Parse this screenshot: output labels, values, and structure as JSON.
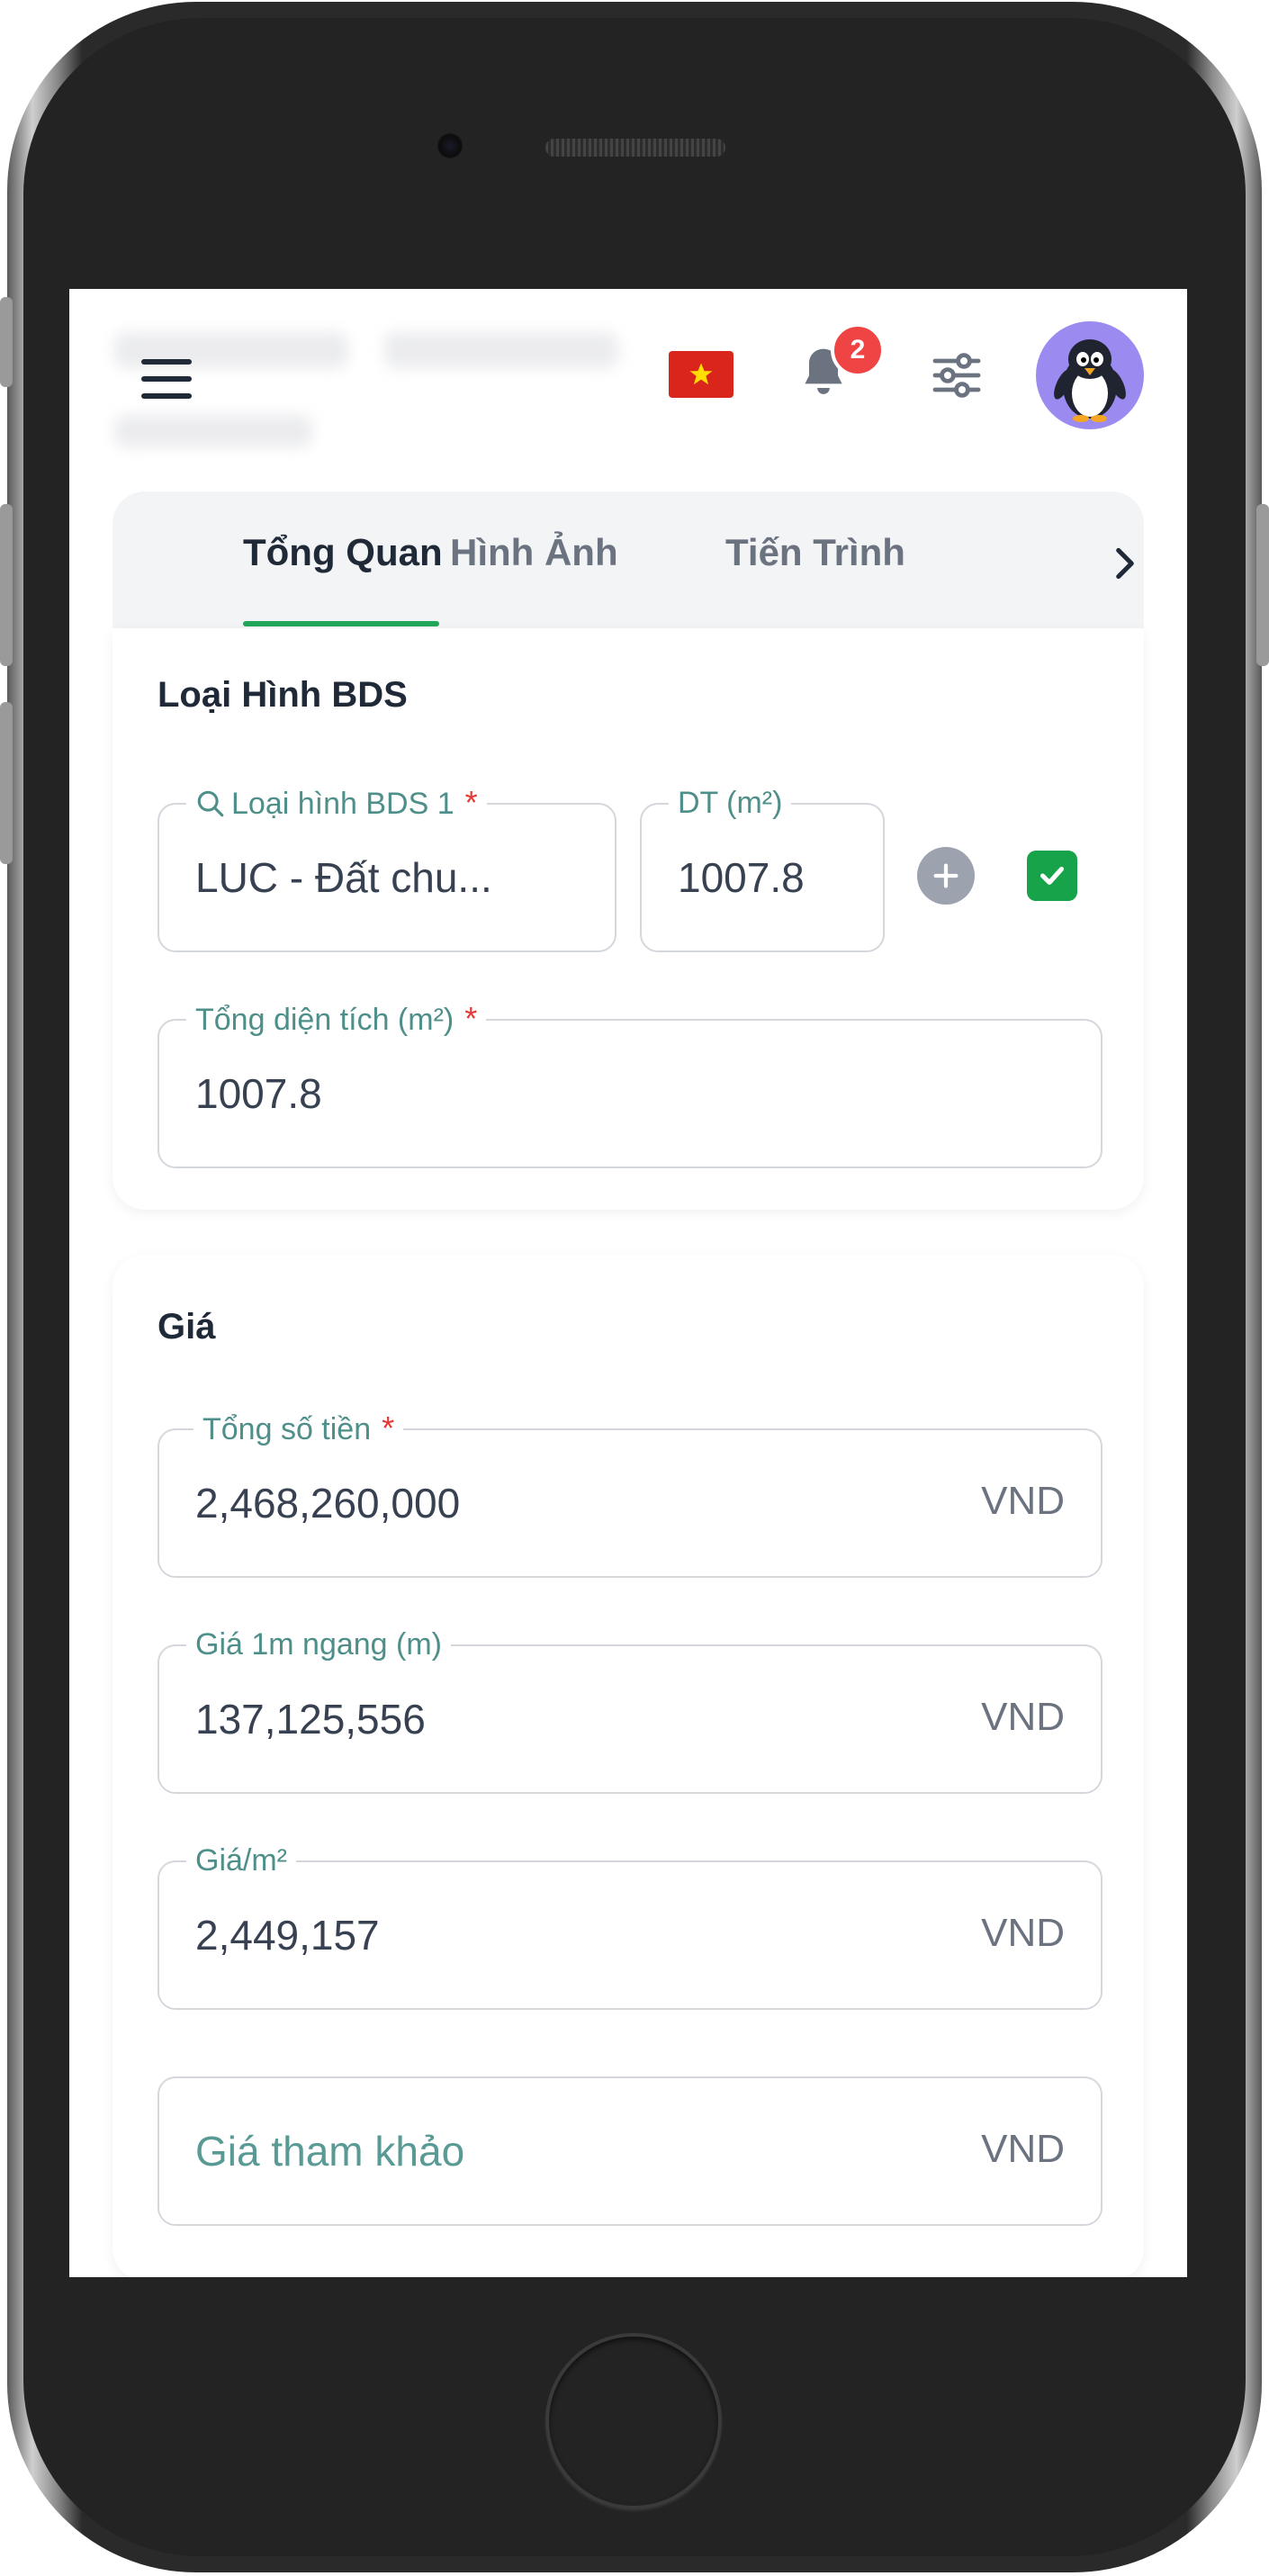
{
  "header": {
    "notification_count": "2",
    "flag": "vn-flag",
    "avatar": "penguin-avatar"
  },
  "tabs": [
    {
      "label": "Tổng Quan",
      "active": true
    },
    {
      "label": "Hình Ảnh",
      "active": false
    },
    {
      "label": "Tiến Trình",
      "active": false
    }
  ],
  "property_type": {
    "section_title": "Loại Hình BDS",
    "type_label": "Loại hình BDS 1",
    "type_value": "LUC - Đất chu...",
    "area_label": "DT (m²)",
    "area_value": "1007.8",
    "total_area_label": "Tổng diện tích (m²)",
    "total_area_value": "1007.8"
  },
  "price": {
    "section_title": "Giá",
    "total_label": "Tổng số tiền",
    "total_value": "2,468,260,000",
    "per_meter_width_label": "Giá 1m ngang (m)",
    "per_meter_width_value": "137,125,556",
    "per_m2_label": "Giá/m²",
    "per_m2_value": "2,449,157",
    "reference_placeholder": "Giá tham khảo",
    "currency": "VND"
  },
  "colors": {
    "accent": "#22a75a",
    "label": "#4f8f8a",
    "required": "#e53935",
    "badge": "#ef4444"
  }
}
